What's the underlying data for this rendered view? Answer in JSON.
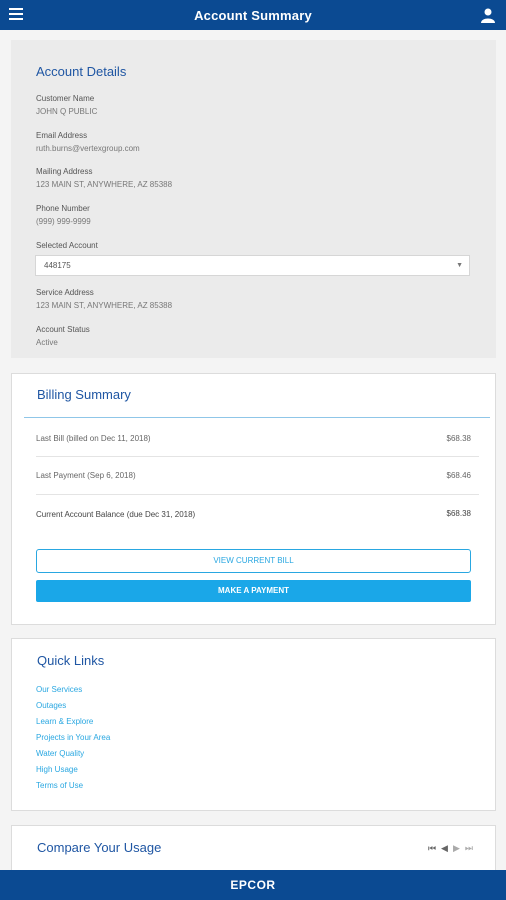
{
  "header": {
    "title": "Account Summary",
    "menu_icon": "hamburger-menu-icon",
    "user_icon": "user-icon"
  },
  "account_details": {
    "title": "Account Details",
    "fields": [
      {
        "label": "Customer Name",
        "value": "JOHN Q PUBLIC"
      },
      {
        "label": "Email Address",
        "value": "ruth.burns@vertexgroup.com"
      },
      {
        "label": "Mailing Address",
        "value": "123 MAIN ST, ANYWHERE, AZ  85388"
      },
      {
        "label": "Phone Number",
        "value": "(999) 999-9999"
      }
    ],
    "selected_account": {
      "label": "Selected Account",
      "value": "448175"
    },
    "fields_after": [
      {
        "label": "Service Address",
        "value": "123 MAIN ST, ANYWHERE, AZ  85388"
      },
      {
        "label": "Account Status",
        "value": "Active"
      }
    ]
  },
  "billing": {
    "title": "Billing Summary",
    "rows": [
      {
        "label": "Last Bill (billed on Dec 11, 2018)",
        "value": "$68.38"
      },
      {
        "label": "Last Payment (Sep 6, 2018)",
        "value": "$68.46"
      },
      {
        "label": "Current Account Balance (due Dec 31, 2018)",
        "value": "$68.38"
      }
    ],
    "view_bill_label": "VIEW CURRENT BILL",
    "make_payment_label": "MAKE A PAYMENT",
    "accent_color": "#1aa7e8"
  },
  "quick_links": {
    "title": "Quick Links",
    "items": [
      "Our Services",
      "Outages",
      "Learn & Explore",
      "Projects in Your Area",
      "Water Quality",
      "High Usage",
      "Terms of Use"
    ]
  },
  "compare_usage": {
    "title": "Compare Your Usage"
  },
  "footer": {
    "logo": "EPCOR",
    "brand_color": "#0b4a92"
  }
}
